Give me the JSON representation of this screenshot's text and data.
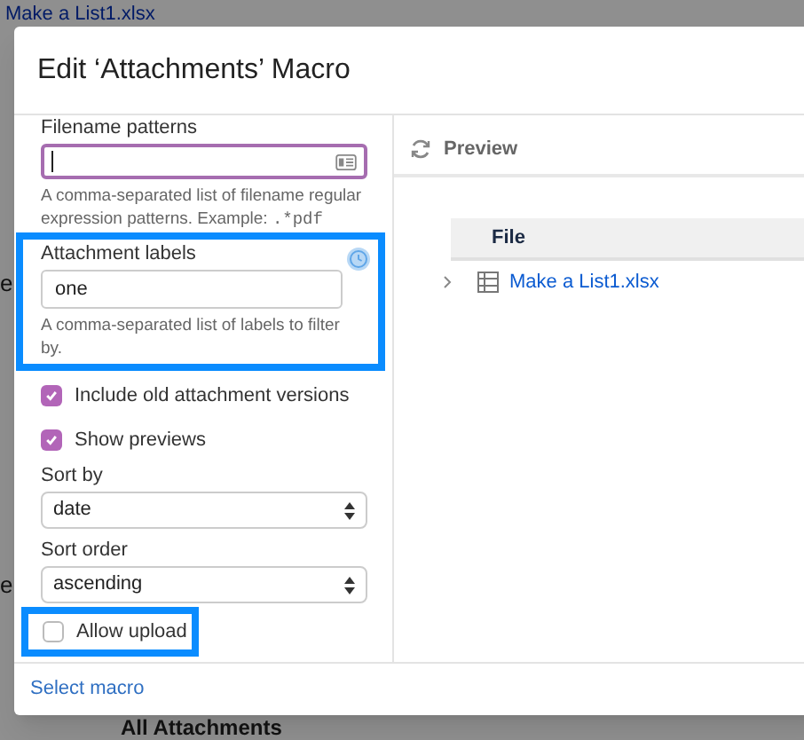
{
  "background": {
    "link": "Make a List1.xlsx",
    "fragments": [
      "e",
      "e"
    ],
    "heading": "All Attachments"
  },
  "dialog": {
    "title": "Edit ‘Attachments’ Macro",
    "filename_patterns": {
      "label": "Filename patterns",
      "help": "A comma-separated list of filename regular expression patterns. Example: ",
      "help_code": ".*pdf",
      "focused": true
    },
    "attachment_labels": {
      "label": "Attachment labels",
      "value": "one",
      "help": "A comma-separated list of labels to filter by.",
      "highlighted": true
    },
    "checkboxes": [
      {
        "label": "Include old attachment versions",
        "checked": true
      },
      {
        "label": "Show previews",
        "checked": true
      }
    ],
    "selects": [
      {
        "label": "Sort by",
        "value": "date"
      },
      {
        "label": "Sort order",
        "value": "ascending"
      }
    ],
    "allow_upload": {
      "label": "Allow upload",
      "checked": false,
      "highlighted": true
    },
    "preview": {
      "title": "Preview",
      "column": "File",
      "rows": [
        {
          "name": "Make a List1.xlsx",
          "expanded": false
        }
      ]
    },
    "footer_link": "Select macro"
  }
}
